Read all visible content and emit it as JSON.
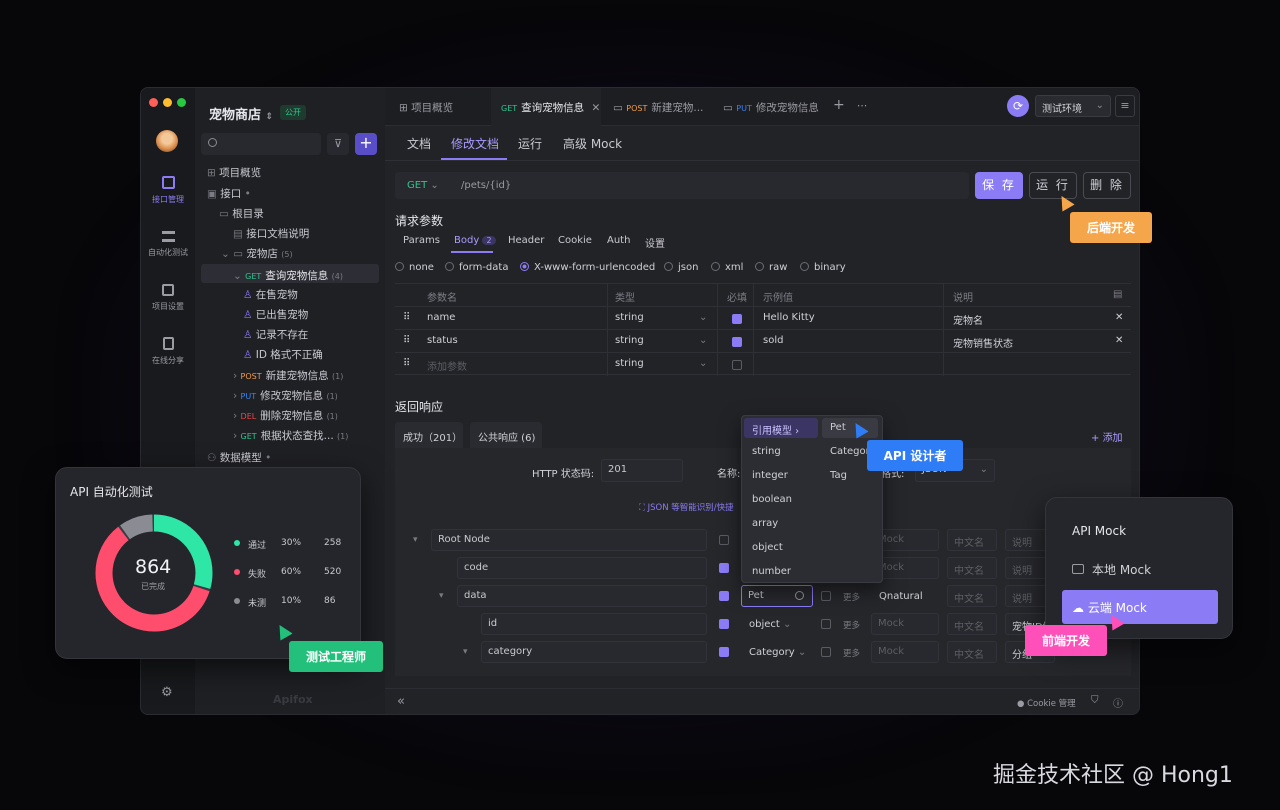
{
  "project": {
    "name": "宠物商店",
    "badge": "公开"
  },
  "rail": {
    "items": [
      "接口管理",
      "自动化测试",
      "项目设置",
      "在线分享"
    ]
  },
  "tree": {
    "overview": "项目概览",
    "interfaces": "接口",
    "root": "根目录",
    "doc": "接口文档说明",
    "folder": "宠物店",
    "folder_count": "(5)",
    "current": {
      "method": "GET",
      "label": "查询宠物信息",
      "count": "(4)"
    },
    "cases": [
      "在售宠物",
      "已出售宠物",
      "记录不存在",
      "ID 格式不正确"
    ],
    "apis": [
      {
        "method": "POST",
        "label": "新建宠物信息",
        "count": "(1)"
      },
      {
        "method": "PUT",
        "label": "修改宠物信息",
        "count": "(1)"
      },
      {
        "method": "DEL",
        "label": "删除宠物信息",
        "count": "(1)"
      },
      {
        "method": "GET",
        "label": "根据状态查找...",
        "count": "(1)"
      }
    ],
    "models": "数据模型",
    "brand": "Apifox"
  },
  "tabs": [
    {
      "label": "项目概览"
    },
    {
      "method": "GET",
      "label": "查询宠物信息"
    },
    {
      "method": "POST",
      "label": "新建宠物..."
    },
    {
      "method": "PUT",
      "label": "修改宠物信息"
    }
  ],
  "env": "测试环境",
  "subtabs": [
    "文档",
    "修改文档",
    "运行",
    "高级 Mock"
  ],
  "request": {
    "method": "GET",
    "path": "/pets/{id}",
    "save": "保 存",
    "run": "运 行",
    "delete": "删 除"
  },
  "params": {
    "title": "请求参数",
    "tabs": [
      "Params",
      "Body",
      "Header",
      "Cookie",
      "Auth",
      "设置"
    ],
    "body_count": "2",
    "types": [
      "none",
      "form-data",
      "X-www-form-urlencoded",
      "json",
      "xml",
      "raw",
      "binary"
    ],
    "headers": [
      "参数名",
      "类型",
      "必填",
      "示例值",
      "说明"
    ],
    "rows": [
      {
        "name": "name",
        "type": "string",
        "example": "Hello Kitty",
        "desc": "宠物名"
      },
      {
        "name": "status",
        "type": "string",
        "example": "sold",
        "desc": "宠物销售状态"
      }
    ],
    "add_placeholder": "添加参数",
    "add_type": "string"
  },
  "response": {
    "title": "返回响应",
    "tabs": [
      "成功（201）",
      "公共响应 (6)"
    ],
    "add": "添加",
    "status_label": "HTTP 状态码:",
    "status_value": "201",
    "name_label": "名称:",
    "format_label": "格式:",
    "format_value": "JSON",
    "smart": "JSON 等智能识别/快捷",
    "rows": [
      {
        "name": "Root Node"
      },
      {
        "name": "code"
      },
      {
        "name": "data",
        "type": "Pet",
        "more": "更多",
        "mock": "Qnatural"
      },
      {
        "name": "id",
        "type": "object",
        "more": "更多",
        "desc": "宠物ID编号"
      },
      {
        "name": "category",
        "type": "Category",
        "more": "更多",
        "desc": "分组"
      }
    ],
    "mock_ph": "Mock",
    "cn_ph": "中文名",
    "desc_ph": "说明"
  },
  "dropdown": {
    "ref": "引用模型",
    "pet": "Pet",
    "items": [
      "string",
      "integer",
      "boolean",
      "array",
      "object",
      "number"
    ],
    "models": [
      "Category",
      "Tag"
    ]
  },
  "footer": {
    "cookie": "Cookie 管理",
    "collapse": "«"
  },
  "auto": {
    "title": "API 自动化测试",
    "total": "864",
    "done": "已完成",
    "legend": [
      {
        "label": "通过",
        "pct": "30%",
        "count": "258",
        "color": "#2ee6a6"
      },
      {
        "label": "失败",
        "pct": "60%",
        "count": "520",
        "color": "#ff4d6d"
      },
      {
        "label": "未测",
        "pct": "10%",
        "count": "86",
        "color": "#8a8b93"
      }
    ]
  },
  "mockcard": {
    "title": "API Mock",
    "local": "本地 Mock",
    "cloud": "云端 Mock"
  },
  "roles": {
    "backend": "后端开发",
    "designer": "API 设计者",
    "tester": "测试工程师",
    "frontend": "前端开发"
  },
  "watermark": "掘金技术社区 @ Hong1"
}
